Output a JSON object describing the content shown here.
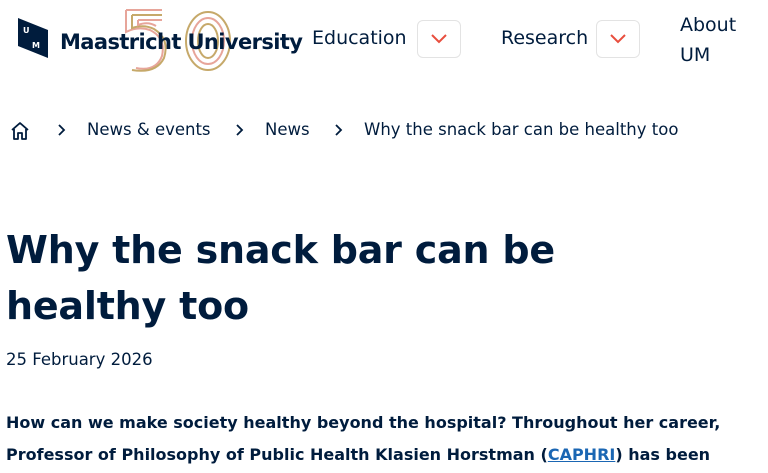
{
  "header": {
    "logo_text": "Maastricht University",
    "logo_mark_letters": "UM",
    "anniversary": "50",
    "nav": [
      {
        "label": "Education",
        "toggle_icon": "chevron-down-icon"
      },
      {
        "label": "Research",
        "toggle_icon": "chevron-down-icon"
      }
    ],
    "about_line1": "About",
    "about_line2": "UM"
  },
  "breadcrumb": {
    "home_icon": "home-icon",
    "items": [
      "News & events",
      "News",
      "Why the snack bar can be healthy too"
    ],
    "separator_icon": "chevron-right-icon"
  },
  "article": {
    "title": "Why the snack bar can be healthy too",
    "date": "25 February 2026",
    "lead_before": "How can we make society healthy beyond the hospital? Throughout her career, Professor of Philosophy of Public Health Klasien Horstman (",
    "lead_link": "CAPHRI",
    "lead_after": ") has been"
  },
  "colors": {
    "navy": "#001c3d",
    "accent_red": "#e84e3e",
    "link": "#1a66b3",
    "anniversary_gold": "#c6a96a",
    "anniversary_pink": "#e7a59a"
  }
}
